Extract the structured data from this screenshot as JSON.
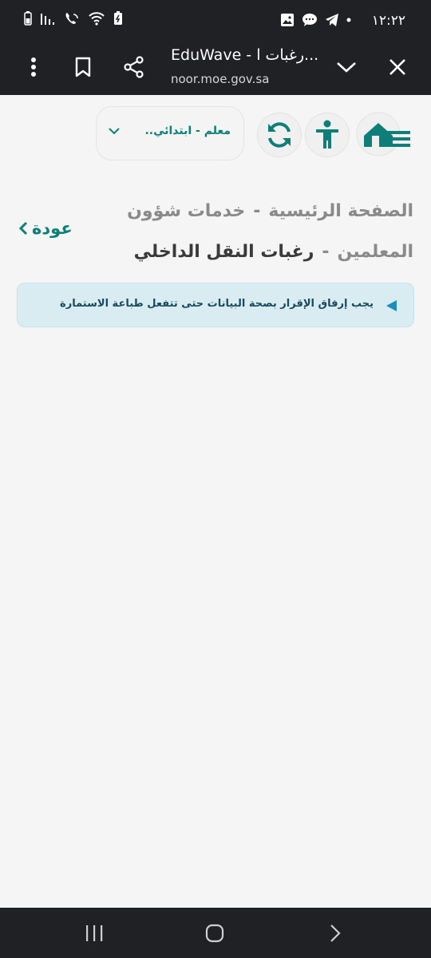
{
  "status_bar": {
    "time": "١٢:٢٢",
    "icons": [
      "battery-icon",
      "signal-icon",
      "wifi-call-icon",
      "wifi-icon",
      "battery-saver-icon",
      "telegram-icon",
      "chat-icon",
      "gallery-icon",
      "dot-icon"
    ]
  },
  "browser": {
    "title": "EduWave - رغبات ا...",
    "url": "noor.moe.gov.sa",
    "icons": [
      "more-vert-icon",
      "bookmark-icon",
      "share-icon",
      "chevron-down-icon",
      "close-icon"
    ]
  },
  "header": {
    "role_select_value": "معلم - ابتدائي..",
    "icons": [
      "home-menu-icon",
      "accessibility-icon",
      "refresh-icon"
    ]
  },
  "breadcrumb": {
    "home": "الصفحة الرئيسية",
    "separator": "-",
    "section": "خدمات شؤون المعلمين",
    "current": "رغبات النقل الداخلي"
  },
  "back_label": "عودة",
  "alert": {
    "text": "يجب إرفاق الإقرار بصحة البيانات حتى تتفعل طباعة الاستمارة"
  },
  "colors": {
    "brand": "#0e7f78",
    "chrome": "#202124",
    "alert_bg": "#d8ecf2"
  },
  "nav_bar": {
    "icons": [
      "recents-icon",
      "home-icon",
      "back-icon"
    ]
  }
}
